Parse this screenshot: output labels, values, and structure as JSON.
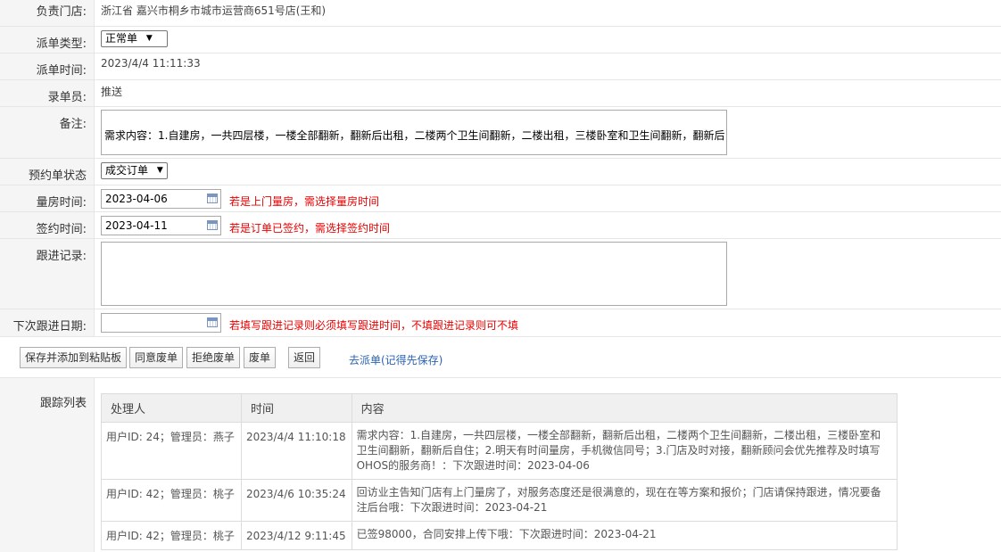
{
  "store": {
    "label": "负责门店:",
    "value": "浙江省 嘉兴市桐乡市城市运营商651号店(王和)"
  },
  "dispatch_type": {
    "label": "派单类型:",
    "selected": "正常单"
  },
  "dispatch_time": {
    "label": "派单时间:",
    "value": "2023/4/4 11:11:33"
  },
  "recorder": {
    "label": "录单员:",
    "value": "推送"
  },
  "remark": {
    "label": "备注:",
    "value": "需求内容：1.自建房，一共四层楼，一楼全部翻新，翻新后出租，二楼两个卫生间翻新，二楼出租，三楼卧室和卫生间翻新，翻新后自"
  },
  "booking_status": {
    "label": "预约单状态",
    "selected": "成交订单"
  },
  "measure_time": {
    "label": "量房时间:",
    "value": "2023-04-06",
    "hint": "若是上门量房，需选择量房时间"
  },
  "sign_time": {
    "label": "签约时间:",
    "value": "2023-04-11",
    "hint": "若是订单已签约，需选择签约时间"
  },
  "followup_record": {
    "label": "跟进记录:",
    "value": ""
  },
  "next_followup": {
    "label": "下次跟进日期:",
    "value": "",
    "hint": "若填写跟进记录则必须填写跟进时间，不填跟进记录则可不填"
  },
  "buttons": {
    "save_clip": "保存并添加到粘贴板",
    "agree_void": "同意废单",
    "reject_void": "拒绝废单",
    "void": "废单",
    "back": "返回",
    "dispatch_link": "去派单(记得先保存)"
  },
  "tracking": {
    "label": "跟踪列表",
    "headers": [
      "处理人",
      "时间",
      "内容"
    ],
    "rows": [
      {
        "handler": "用户ID: 24；管理员：燕子",
        "time": "2023/4/4 11:10:18",
        "content": "需求内容：1.自建房，一共四层楼，一楼全部翻新，翻新后出租，二楼两个卫生间翻新，二楼出租，三楼卧室和卫生间翻新，翻新后自住；2.明天有时间量房，手机微信同号；3.门店及时对接，翻新顾问会优先推荐及时填写OHOS的服务商！：下次跟进时间：2023-04-06"
      },
      {
        "handler": "用户ID: 42；管理员：桃子",
        "time": "2023/4/6 10:35:24",
        "content": "回访业主告知门店有上门量房了，对服务态度还是很满意的，现在在等方案和报价；门店请保持跟进，情况要备注后台哦：下次跟进时间：2023-04-21"
      },
      {
        "handler": "用户ID: 42；管理员：桃子",
        "time": "2023/4/12 9:11:45",
        "content": "已签98000，合同安排上传下哦：下次跟进时间：2023-04-21"
      }
    ]
  }
}
